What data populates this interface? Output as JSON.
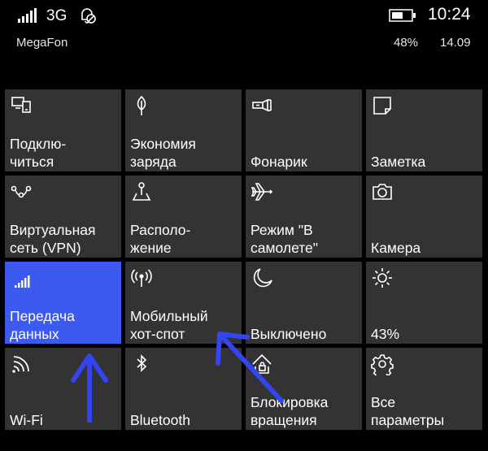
{
  "status_bar": {
    "network_type": "3G",
    "time": "10:24",
    "icons": {
      "signal": "signal-strength-icon",
      "quiet_hours": "quiet-hours-icon",
      "battery": "battery-icon"
    }
  },
  "info": {
    "carrier": "MegaFon",
    "battery_percent": "48%",
    "date": "14.09"
  },
  "tiles": [
    {
      "label": "Подклю-\nчиться",
      "icon": "connect-icon",
      "active": false
    },
    {
      "label": "Экономия\nзаряда",
      "icon": "battery-saver-icon",
      "active": false
    },
    {
      "label": "Фонарик",
      "icon": "flashlight-icon",
      "active": false
    },
    {
      "label": "Заметка",
      "icon": "note-icon",
      "active": false
    },
    {
      "label": "Виртуальная\nсеть (VPN)",
      "icon": "vpn-icon",
      "active": false
    },
    {
      "label": "Располо-\nжение",
      "icon": "location-icon",
      "active": false
    },
    {
      "label": "Режим \"В\nсамолете\"",
      "icon": "airplane-icon",
      "active": false
    },
    {
      "label": "Камера",
      "icon": "camera-icon",
      "active": false
    },
    {
      "label": "Передача\nданных",
      "icon": "cellular-data-icon",
      "active": true
    },
    {
      "label": "Мобильный\nхот-спот",
      "icon": "hotspot-icon",
      "active": false
    },
    {
      "label": "Выключено",
      "icon": "moon-icon",
      "active": false
    },
    {
      "label": "43%",
      "icon": "brightness-icon",
      "active": false
    },
    {
      "label": "Wi-Fi",
      "icon": "wifi-icon",
      "active": false
    },
    {
      "label": "Bluetooth",
      "icon": "bluetooth-icon",
      "active": false
    },
    {
      "label": "Блокировка\nвращения",
      "icon": "rotation-lock-icon",
      "active": false
    },
    {
      "label": "Все\nпараметры",
      "icon": "gear-icon",
      "active": false
    }
  ],
  "colors": {
    "tile": "#333333",
    "tile_active": "#3c5af0",
    "annotation_arrow": "#3344f2"
  }
}
